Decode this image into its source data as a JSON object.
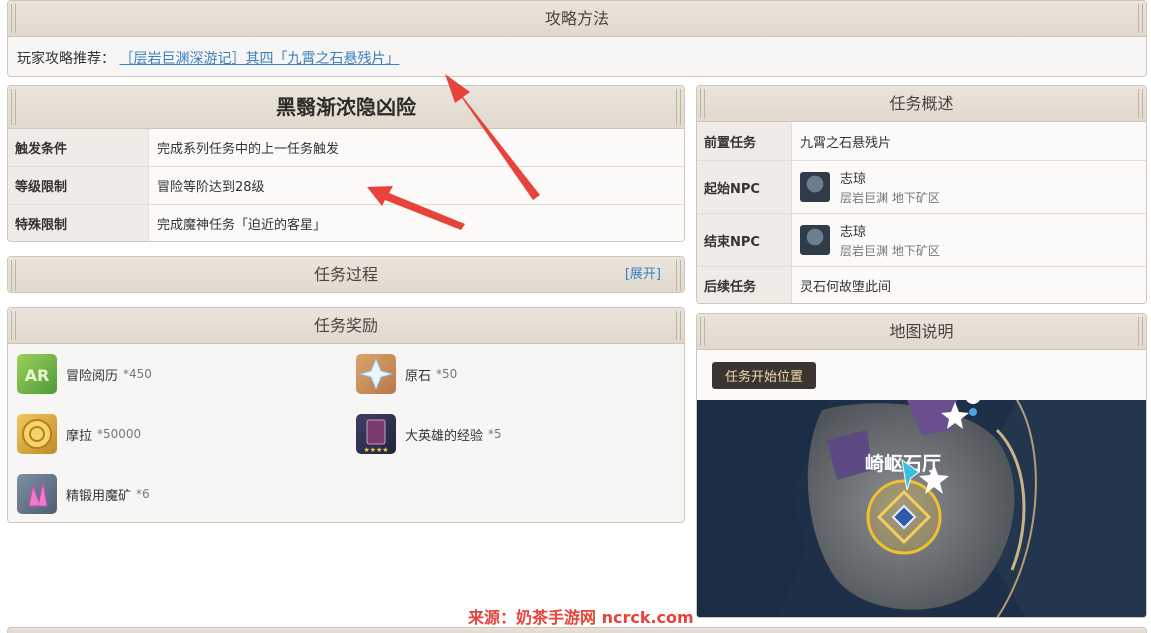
{
  "strategy": {
    "title": "攻略方法",
    "prefix": "玩家攻略推荐：",
    "link": "［层岩巨渊深游记］其四「九霄之石悬残片」"
  },
  "quest": {
    "name": "黑翳渐浓隐凶险",
    "rows": [
      {
        "key": "触发条件",
        "value": "完成系列任务中的上一任务触发"
      },
      {
        "key": "等级限制",
        "value": "冒险等阶达到28级"
      },
      {
        "key": "特殊限制",
        "value": "完成魔神任务「迫近的客星」"
      }
    ]
  },
  "process": {
    "title": "任务过程",
    "expand": "[展开]"
  },
  "rewards": {
    "title": "任务奖励",
    "items": [
      {
        "name": "冒险阅历",
        "count": "*450",
        "icon": "adventure-exp-icon"
      },
      {
        "name": "原石",
        "count": "*50",
        "icon": "primogem-icon"
      },
      {
        "name": "摩拉",
        "count": "*50000",
        "icon": "mora-icon"
      },
      {
        "name": "大英雄的经验",
        "count": "*5",
        "icon": "heros-wit-icon"
      },
      {
        "name": "精锻用魔矿",
        "count": "*6",
        "icon": "enhancement-ore-icon"
      }
    ]
  },
  "overview": {
    "title": "任务概述",
    "prev_label": "前置任务",
    "prev_value": "九霄之石悬残片",
    "start_label": "起始NPC",
    "start_name": "志琼",
    "start_loc": "层岩巨渊 地下矿区",
    "end_label": "结束NPC",
    "end_name": "志琼",
    "end_loc": "层岩巨渊 地下矿区",
    "next_label": "后续任务",
    "next_value": "灵石何故堕此间"
  },
  "map": {
    "title": "地图说明",
    "button": "任务开始位置",
    "place_label": "崎岖石厅"
  },
  "watermark": "来源：奶茶手游网 ncrck.com",
  "colors": {
    "accent_link": "#3a7fc1",
    "arrow_red": "#e8433a",
    "map_marker": "#f0c030"
  }
}
